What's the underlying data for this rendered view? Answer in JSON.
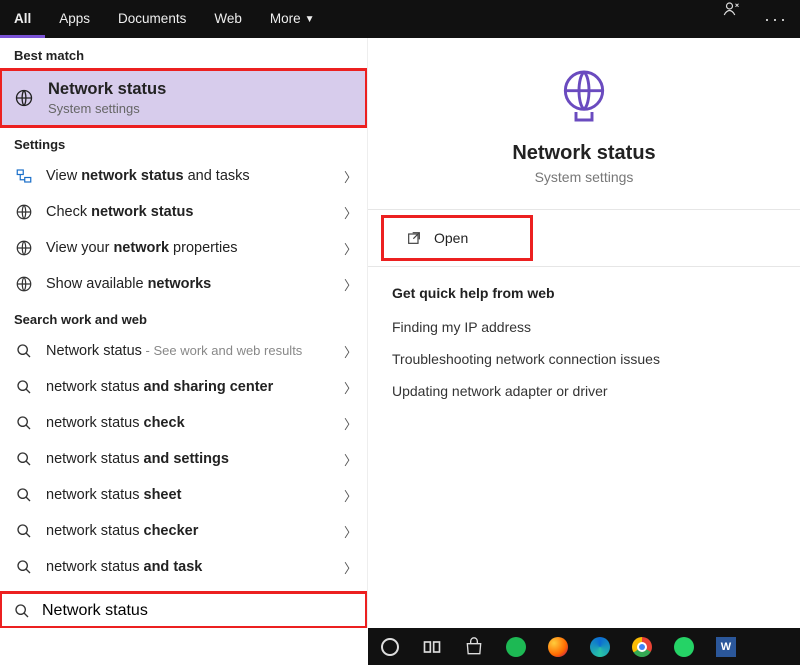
{
  "tabs": {
    "all": "All",
    "apps": "Apps",
    "documents": "Documents",
    "web": "Web",
    "more": "More"
  },
  "left": {
    "best_match_header": "Best match",
    "selected": {
      "title": "Network status",
      "subtitle": "System settings"
    },
    "settings_header": "Settings",
    "settings_items": [
      {
        "prefix": "View ",
        "bold": "network status",
        "suffix": " and tasks"
      },
      {
        "prefix": "Check ",
        "bold": "network status",
        "suffix": ""
      },
      {
        "prefix": "View your ",
        "bold": "network",
        "suffix": " properties"
      },
      {
        "prefix": "Show available ",
        "bold": "networks",
        "suffix": ""
      }
    ],
    "web_header": "Search work and web",
    "web_items": [
      {
        "prefix": "Network status",
        "bold": "",
        "suffix": "",
        "hint": " - See work and web results"
      },
      {
        "prefix": "network status ",
        "bold": "and sharing center",
        "suffix": ""
      },
      {
        "prefix": "network status ",
        "bold": "check",
        "suffix": ""
      },
      {
        "prefix": "network status ",
        "bold": "and settings",
        "suffix": ""
      },
      {
        "prefix": "network status ",
        "bold": "sheet",
        "suffix": ""
      },
      {
        "prefix": "network status ",
        "bold": "checker",
        "suffix": ""
      },
      {
        "prefix": "network status ",
        "bold": "and task",
        "suffix": ""
      }
    ],
    "search_value": "Network status"
  },
  "preview": {
    "title": "Network status",
    "subtitle": "System settings",
    "open_label": "Open",
    "help_header": "Get quick help from web",
    "help_items": [
      "Finding my IP address",
      "Troubleshooting network connection issues",
      "Updating network adapter or driver"
    ]
  },
  "accent_color": "#6a4bbf"
}
